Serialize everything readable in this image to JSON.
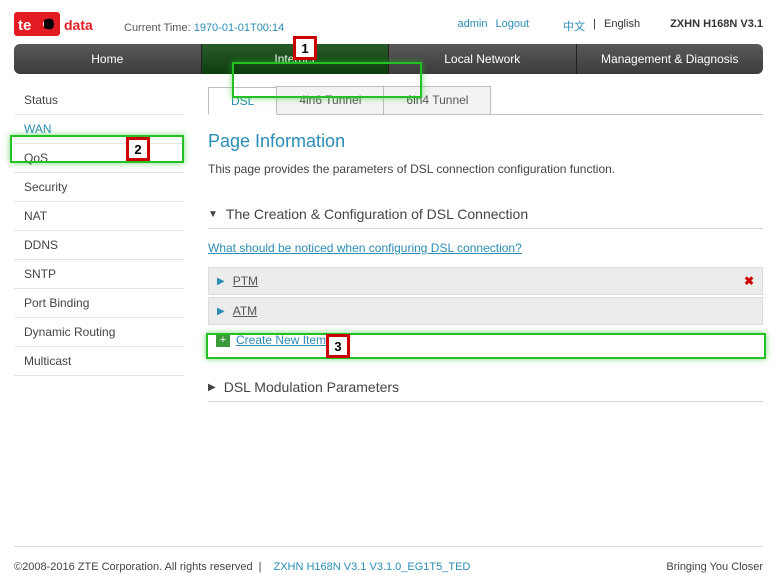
{
  "header": {
    "logo_text": "te data",
    "current_time_label": "Current Time:",
    "current_time_value": "1970-01-01T00:14",
    "user": "admin",
    "logout": "Logout",
    "lang_cn": "中文",
    "lang_en": "English",
    "model": "ZXHN H168N V3.1"
  },
  "topnav": [
    "Home",
    "Internet",
    "Local Network",
    "Management & Diagnosis"
  ],
  "topnav_active": 1,
  "sidebar": [
    "Status",
    "WAN",
    "QoS",
    "Security",
    "NAT",
    "DDNS",
    "SNTP",
    "Port Binding",
    "Dynamic Routing",
    "Multicast"
  ],
  "sidebar_active": 1,
  "tabs": [
    "DSL",
    "4in6 Tunnel",
    "6in4 Tunnel"
  ],
  "tabs_active": 0,
  "page": {
    "title": "Page Information",
    "desc": "This page provides the parameters of DSL connection configuration function."
  },
  "section1": {
    "title": "The Creation & Configuration of DSL Connection",
    "help_link": "What should be noticed when configuring DSL connection?",
    "connections": [
      "PTM",
      "ATM"
    ],
    "create_label": "Create New Item"
  },
  "section2": {
    "title": "DSL Modulation Parameters"
  },
  "footer": {
    "copyright": "©2008-2016 ZTE Corporation. All rights reserved",
    "sep": "|",
    "firmware": "ZXHN H168N V3.1 V3.1.0_EG1T5_TED",
    "tagline": "Bringing You Closer"
  },
  "annotations": {
    "1": "1",
    "2": "2",
    "3": "3"
  }
}
